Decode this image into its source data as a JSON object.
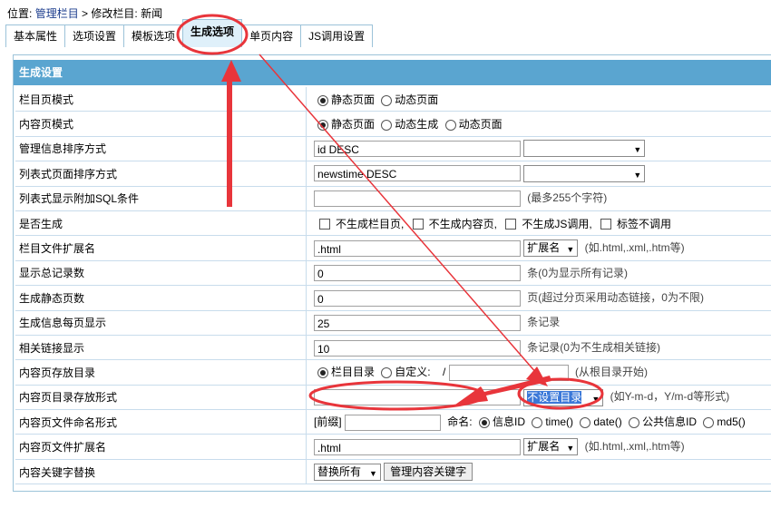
{
  "breadcrumb": {
    "prefix": "位置:",
    "link": "管理栏目",
    "sep": ">",
    "current": "修改栏目: 新闻"
  },
  "tabs": [
    "基本属性",
    "选项设置",
    "模板选项",
    "生成选项",
    "单页内容",
    "JS调用设置"
  ],
  "active_tab": "生成选项",
  "panel_title": "生成设置",
  "rows": {
    "r0": {
      "label": "栏目页模式",
      "opt1": "静态页面",
      "opt2": "动态页面"
    },
    "r1": {
      "label": "内容页模式",
      "opt1": "静态页面",
      "opt2": "动态生成",
      "opt3": "动态页面"
    },
    "r2": {
      "label": "管理信息排序方式",
      "value": "id DESC"
    },
    "r3": {
      "label": "列表式页面排序方式",
      "value": "newstime DESC"
    },
    "r4": {
      "label": "列表式显示附加SQL条件",
      "hint": "(最多255个字符)"
    },
    "r5": {
      "label": "是否生成",
      "c1": "不生成栏目页,",
      "c2": "不生成内容页,",
      "c3": "不生成JS调用,",
      "c4": "标签不调用"
    },
    "r6": {
      "label": "栏目文件扩展名",
      "value": ".html",
      "select": "扩展名",
      "hint": "(如.html,.xml,.htm等)"
    },
    "r7": {
      "label": "显示总记录数",
      "value": "0",
      "hint": "条(0为显示所有记录)"
    },
    "r8": {
      "label": "生成静态页数",
      "value": "0",
      "hint": "页(超过分页采用动态链接，0为不限)"
    },
    "r9": {
      "label": "生成信息每页显示",
      "value": "25",
      "hint": "条记录"
    },
    "r10": {
      "label": "相关链接显示",
      "value": "10",
      "hint": "条记录(0为不生成相关链接)"
    },
    "r11": {
      "label": "内容页存放目录",
      "opt1": "栏目目录",
      "opt2": "自定义:",
      "slash": "/",
      "hint": "(从根目录开始)"
    },
    "r12": {
      "label": "内容页目录存放形式",
      "select": "不设置目录",
      "hint": "(如Y-m-d，Y/m-d等形式)"
    },
    "r13": {
      "label": "内容页文件命名形式",
      "prefix": "[前缀]",
      "name": "命名:",
      "o1": "信息ID",
      "o2": "time()",
      "o3": "date()",
      "o4": "公共信息ID",
      "o5": "md5()"
    },
    "r14": {
      "label": "内容页文件扩展名",
      "value": ".html",
      "select": "扩展名",
      "hint": "(如.html,.xml,.htm等)"
    },
    "r15": {
      "label": "内容关键字替换",
      "select": "替换所有",
      "button": "管理内容关键字"
    }
  },
  "annotation_color": "#e8353b"
}
